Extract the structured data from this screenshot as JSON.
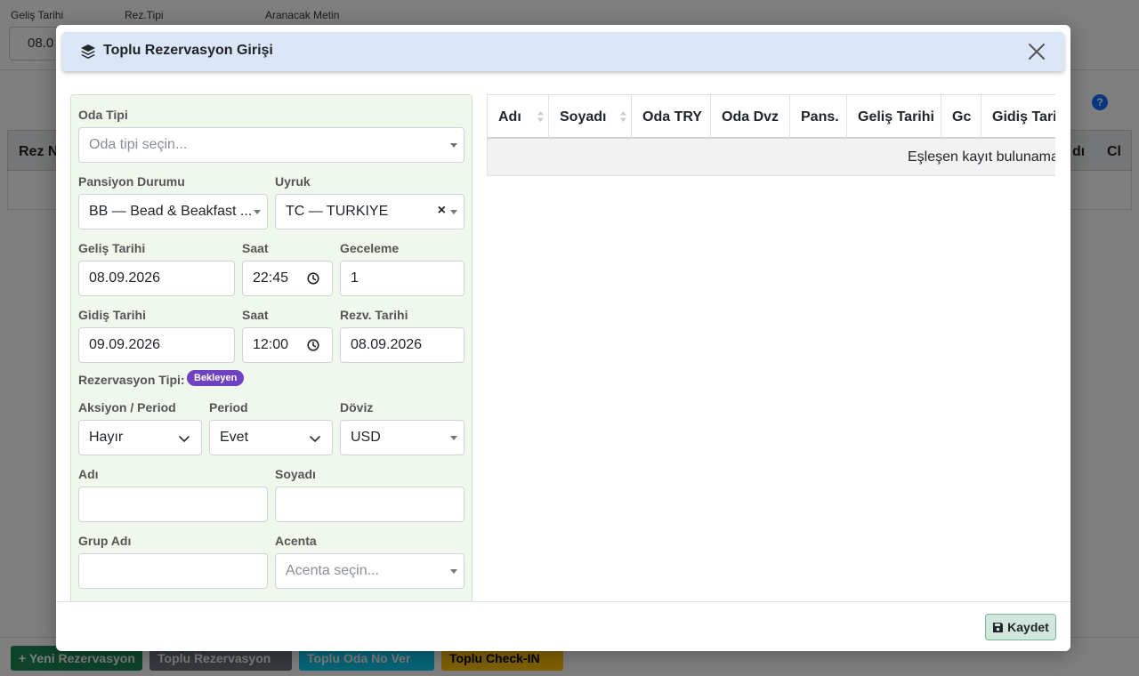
{
  "background": {
    "filters": {
      "arrival_label": "Geliş Tarihi",
      "arrival_value": "08.0",
      "res_type_label": "Rez.Tipi",
      "search_label": "Aranacak Metin"
    },
    "help_symbol": "?",
    "table_headers": [
      "Rez N",
      "dı",
      "Cl"
    ],
    "buttons": {
      "new_res": "+ Yeni Rezervasyon",
      "bulk_res": "Toplu Rezervasyon",
      "bulk_room": "Toplu Oda No Ver",
      "bulk_checkin": "Toplu Check-IN"
    }
  },
  "modal": {
    "title": "Toplu Rezervasyon Girişi",
    "form": {
      "room_type": {
        "label": "Oda Tipi",
        "placeholder": "Oda tipi seçin..."
      },
      "board": {
        "label": "Pansiyon Durumu",
        "value": "BB — Bead & Beakfast ..."
      },
      "nationality": {
        "label": "Uyruk",
        "value": "TC — TURKIYE",
        "clear": "×"
      },
      "arrival_date": {
        "label": "Geliş Tarihi",
        "value": "08.09.2026"
      },
      "arrival_time": {
        "label": "Saat",
        "value": "22:45"
      },
      "nights": {
        "label": "Geceleme",
        "value": "1"
      },
      "departure_date": {
        "label": "Gidiş Tarihi",
        "value": "09.09.2026"
      },
      "departure_time": {
        "label": "Saat",
        "value": "12:00"
      },
      "res_date": {
        "label": "Rezv. Tarihi",
        "value": "08.09.2026"
      },
      "res_type": {
        "label": "Rezervasyon Tipi:",
        "badge": "Bekleyen"
      },
      "action_period": {
        "label": "Aksiyon / Period",
        "value": "Hayır"
      },
      "period": {
        "label": "Period",
        "value": "Evet"
      },
      "currency": {
        "label": "Döviz",
        "value": "USD"
      },
      "first_name": {
        "label": "Adı",
        "value": ""
      },
      "last_name": {
        "label": "Soyadı",
        "value": ""
      },
      "group_name": {
        "label": "Grup Adı",
        "value": ""
      },
      "agency": {
        "label": "Acenta",
        "placeholder": "Acenta seçin..."
      }
    },
    "table": {
      "headers": [
        "Adı",
        "Soyadı",
        "Oda TRY",
        "Oda Dvz",
        "Pans.",
        "Geliş Tarihi",
        "Gc",
        "Gidiş Tarihi"
      ],
      "empty_message": "Eşleşen kayıt bulunamadı"
    },
    "save_label": "Kaydet"
  },
  "colors": {
    "header_bg": "#dbe7f8",
    "form_bg": "#f0f7ec",
    "badge": "#6f42c1",
    "save_bg": "#d1e7dd"
  }
}
